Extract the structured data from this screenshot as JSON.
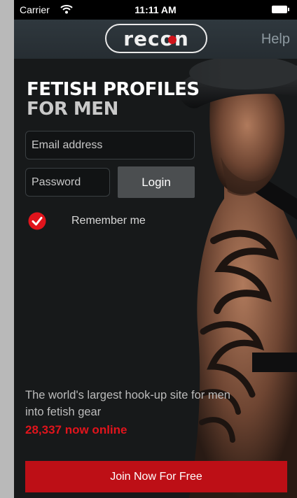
{
  "status_bar": {
    "carrier": "Carrier",
    "time": "11:11 AM",
    "icons": [
      "wifi-icon",
      "battery-icon"
    ]
  },
  "nav": {
    "logo_text": "recon",
    "help_label": "Help"
  },
  "login": {
    "headline_line1": "FETISH PROFILES",
    "headline_line2": "FOR MEN",
    "email_placeholder": "Email address",
    "password_placeholder": "Password",
    "login_label": "Login",
    "remember_label": "Remember me",
    "remember_checked": true
  },
  "promo": {
    "tagline": "The world's largest hook-up site for men into fetish gear",
    "online_count": "28,337 now online",
    "join_label": "Join Now For Free"
  },
  "colors": {
    "accent_red": "#e1141c",
    "join_red": "#bd0f16",
    "background": "#17191a",
    "navbar": "#2b3338"
  }
}
